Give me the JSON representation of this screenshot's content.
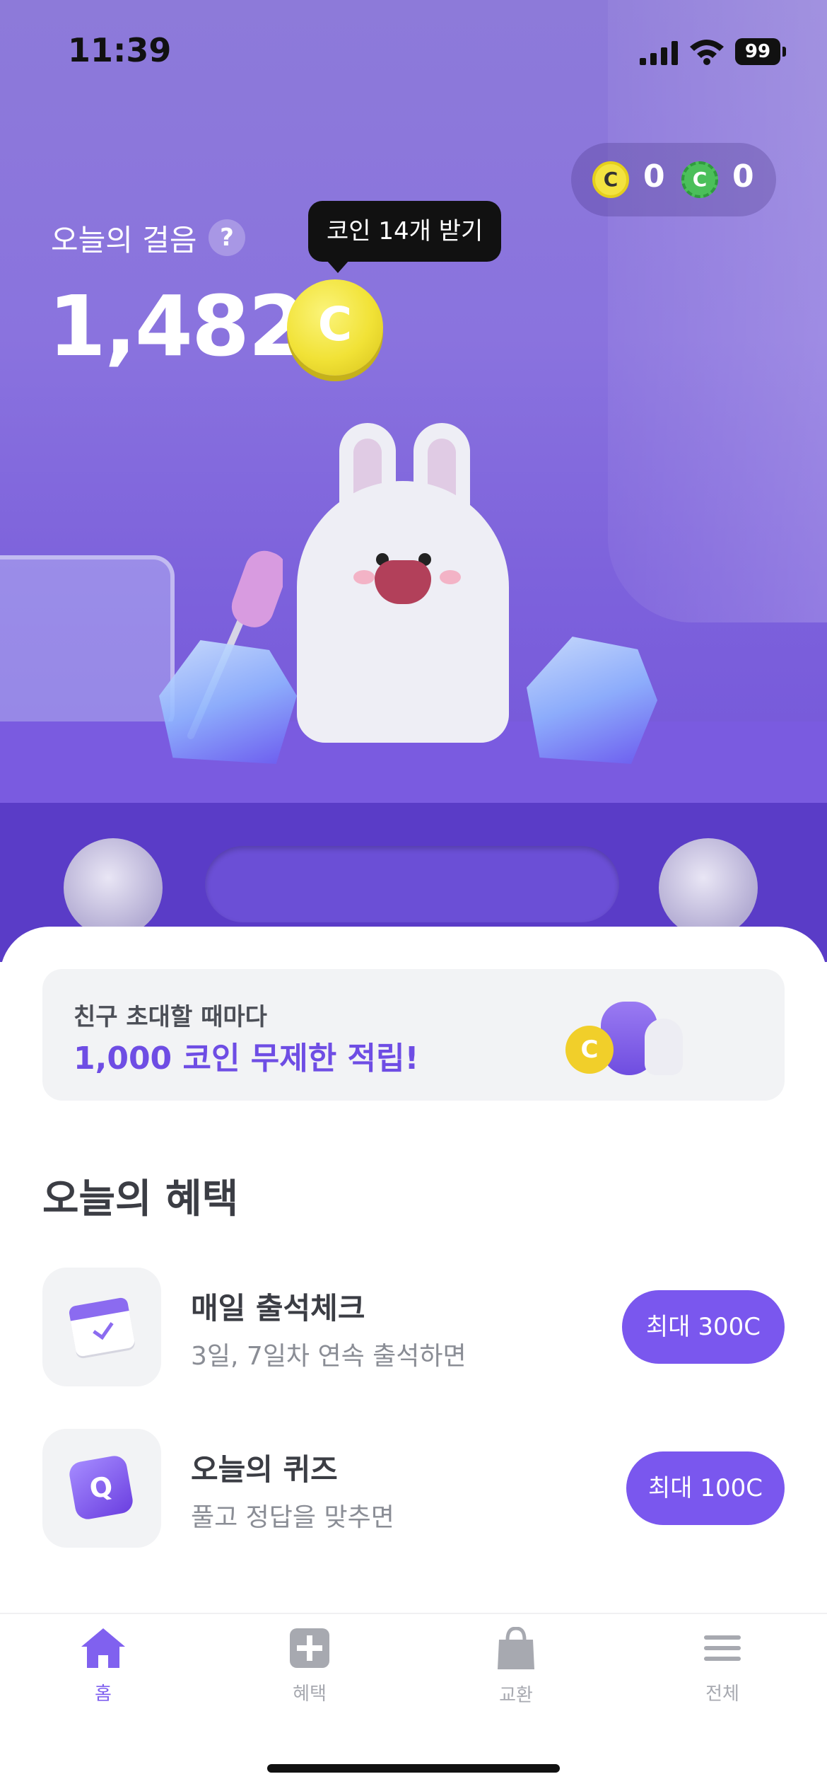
{
  "status_bar": {
    "time": "11:39",
    "battery": "99"
  },
  "coins": {
    "yellow_icon": "C",
    "yellow_count": "0",
    "green_icon": "C",
    "green_count": "0"
  },
  "steps": {
    "label": "오늘의 걸음",
    "help": "?",
    "value": "1,482",
    "coin_icon": "C",
    "tooltip": "코인 14개 받기"
  },
  "banner": {
    "line1": "친구 초대할 때마다",
    "line2": "1,000 코인 무제한 적립!",
    "coin_icon": "C"
  },
  "benefits": {
    "title": "오늘의 혜택",
    "items": [
      {
        "title": "매일 출석체크",
        "subtitle": "3일, 7일차 연속 출석하면",
        "button": "최대 300C",
        "icon": "calendar-check-icon"
      },
      {
        "title": "오늘의 퀴즈",
        "subtitle": "풀고 정답을 맞추면",
        "button": "최대 100C",
        "icon_text": "Q",
        "icon": "quiz-icon"
      }
    ]
  },
  "tabs": [
    {
      "label": "홈",
      "icon": "home-icon",
      "active": true
    },
    {
      "label": "혜택",
      "icon": "plus-square-icon"
    },
    {
      "label": "교환",
      "icon": "shopping-bag-icon"
    },
    {
      "label": "전체",
      "icon": "menu-icon"
    }
  ],
  "colors": {
    "accent": "#7a57ee",
    "hero_top": "#8d7ad9",
    "hero_bottom": "#6f4fd8"
  }
}
